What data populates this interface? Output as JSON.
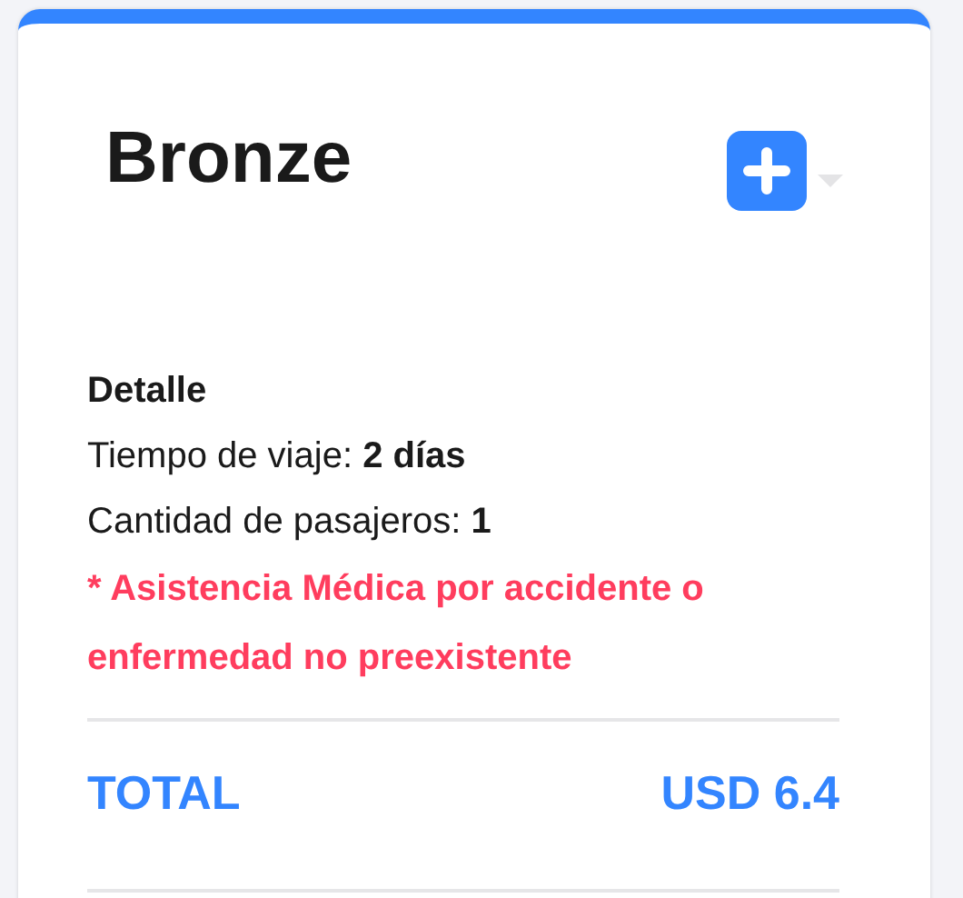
{
  "plan": {
    "title": "Bronze"
  },
  "detail": {
    "heading": "Detalle",
    "rows": [
      {
        "label": "Tiempo de viaje:",
        "value": "2 días"
      },
      {
        "label": "Cantidad de pasajeros:",
        "value": "1"
      }
    ],
    "note": "* Asistencia Médica por accidente o enfermedad no preexistente"
  },
  "total": {
    "label": "TOTAL",
    "amount": "USD 6.4"
  }
}
